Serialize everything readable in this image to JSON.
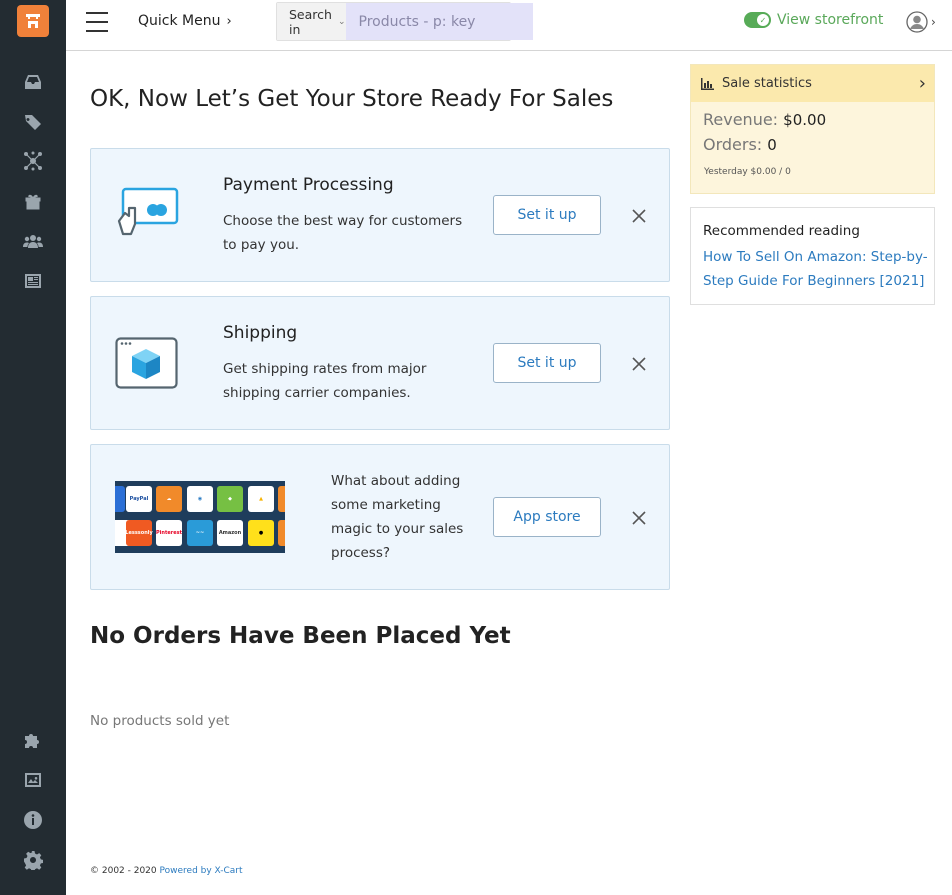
{
  "header": {
    "quick_menu": "Quick Menu",
    "search_in": "Search in",
    "search_placeholder": "Products - p: key",
    "view_storefront": "View storefront"
  },
  "main": {
    "title": "OK, Now Let’s Get Your Store Ready For Sales",
    "cards": [
      {
        "title": "Payment Processing",
        "desc_line1": "Choose the best way for customers",
        "desc_line2": "to pay you.",
        "button": "Set it up"
      },
      {
        "title": "Shipping",
        "desc_line1": "Get shipping rates from major",
        "desc_line2": "shipping carrier companies.",
        "button": "Set it up"
      },
      {
        "desc_line1": "What about adding",
        "desc_line2": "some marketing",
        "desc_line3": "magic to your sales",
        "desc_line4": "process?",
        "button": "App store",
        "tiles": [
          "PayPal",
          "Pinterest",
          "Lesssonly",
          "Amazon"
        ]
      }
    ],
    "orders_title": "No Orders Have Been Placed Yet",
    "no_products": "No products sold yet"
  },
  "stats": {
    "title": "Sale statistics",
    "revenue_label": "Revenue:",
    "revenue_value": "$0.00",
    "orders_label": "Orders:",
    "orders_value": "0",
    "yesterday": "Yesterday $0.00 / 0"
  },
  "reading": {
    "title": "Recommended reading",
    "link_line1": "How To Sell On Amazon: Step-by-",
    "link_line2": "Step Guide For Beginners [2021]"
  },
  "footer": {
    "copyright": "© 2002 - 2020",
    "powered": "Powered by X-Cart"
  },
  "colors": {
    "sidebar": "#232c32",
    "accent": "#f0813a",
    "link": "#2c7bbf",
    "card_bg": "#eef6fd",
    "stats_bg": "#fdf5dc"
  }
}
